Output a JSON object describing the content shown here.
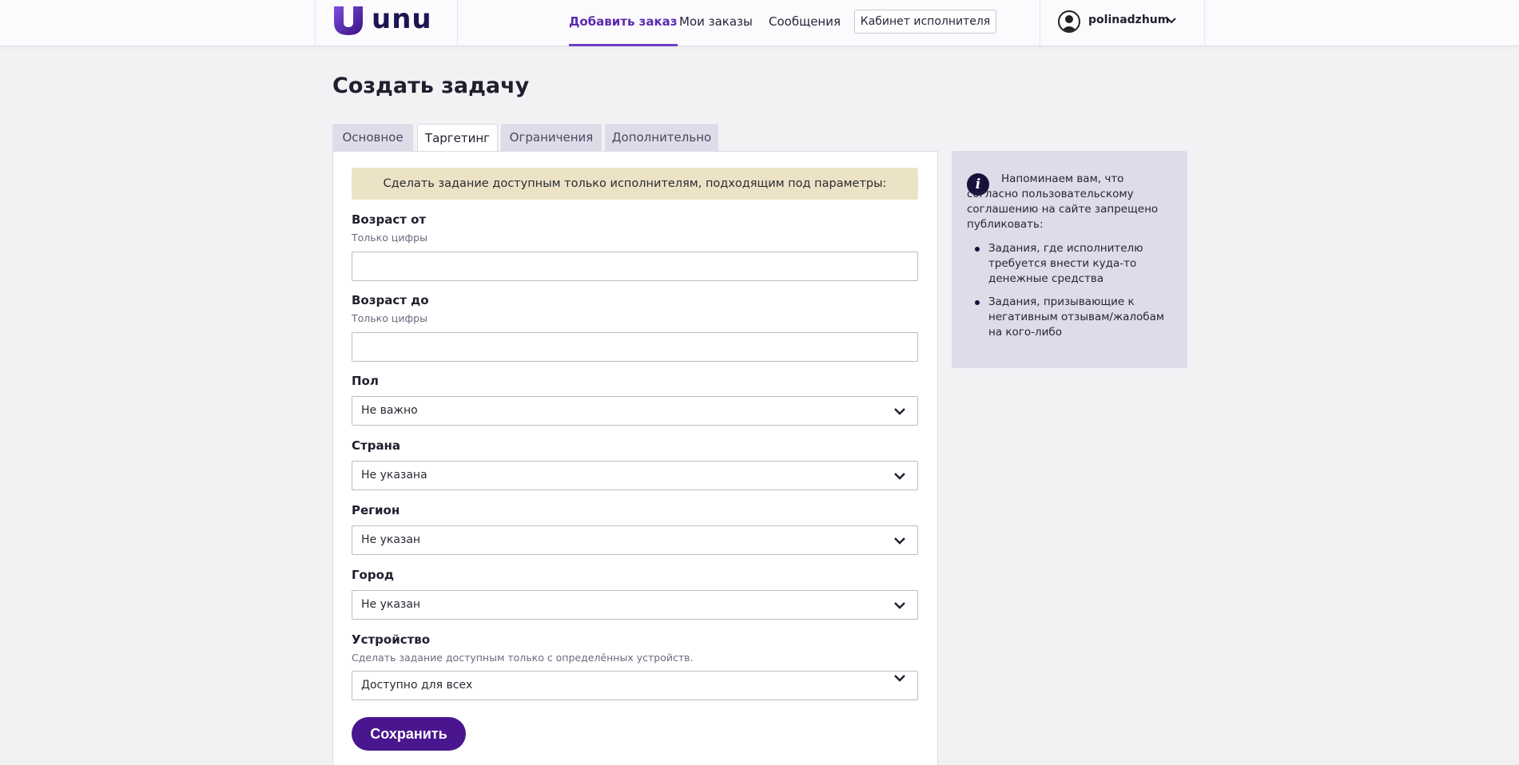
{
  "brand": {
    "name": "unu",
    "accent": "#5b2bb0",
    "logo_color": "#4a168f"
  },
  "nav": {
    "items": [
      {
        "label": "Добавить заказ",
        "active": true
      },
      {
        "label": "Мои заказы",
        "active": false
      },
      {
        "label": "Сообщения",
        "active": false
      }
    ],
    "cabinet_button": "Кабинет исполнителя",
    "username": "polinadzhum"
  },
  "page": {
    "title": "Создать задачу"
  },
  "tabs": [
    {
      "label": "Основное",
      "active": false
    },
    {
      "label": "Таргетинг",
      "active": true
    },
    {
      "label": "Ограничения",
      "active": false
    },
    {
      "label": "Дополнительно",
      "active": false
    }
  ],
  "form": {
    "notice": "Сделать задание доступным только исполнителям, подходящим под параметры:",
    "age_from": {
      "label": "Возраст от",
      "hint": "Только цифры",
      "value": ""
    },
    "age_to": {
      "label": "Возраст до",
      "hint": "Только цифры",
      "value": ""
    },
    "gender": {
      "label": "Пол",
      "value": "Не важно"
    },
    "country": {
      "label": "Страна",
      "value": "Не указана"
    },
    "region": {
      "label": "Регион",
      "value": "Не указан"
    },
    "city": {
      "label": "Город",
      "value": "Не указан"
    },
    "device": {
      "label": "Устройство",
      "hint": "Сделать задание доступным только с определённых устройств.",
      "value": "Доступно для всех"
    },
    "save_label": "Сохранить"
  },
  "info": {
    "icon": "info-icon",
    "text": "Напоминаем вам, что согласно пользовательскому соглашению на сайте запрещено публиковать:",
    "items": [
      "Задания, где исполнителю требуется внести куда-то денежные средства",
      "Задания, призывающие к негативным отзывам/жалобам на кого-либо"
    ]
  }
}
